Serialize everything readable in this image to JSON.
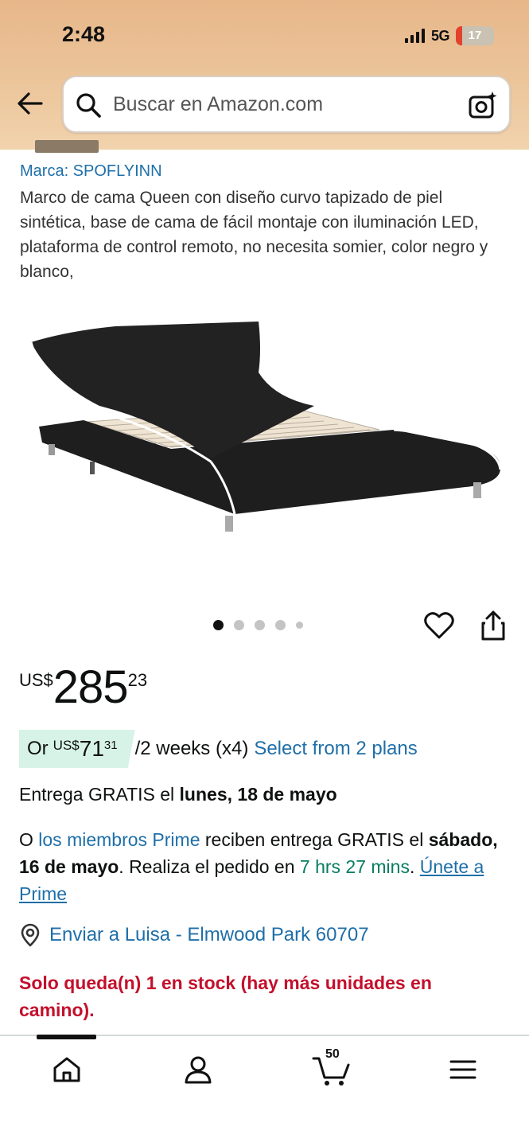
{
  "status_bar": {
    "time": "2:48",
    "network": "5G",
    "battery_level": "17",
    "battery_color": "#e2412d"
  },
  "search": {
    "placeholder": "Buscar en Amazon.com",
    "icons": [
      "back-arrow-icon",
      "search-icon",
      "camera-icon"
    ]
  },
  "product": {
    "brand": "Marca: SPOFLYINN",
    "title": "Marco de cama Queen con diseño curvo tapizado de piel sintética, base de cama de fácil montaje con iluminación LED, plataforma de control remoto, no necesita somier, color negro y blanco,",
    "carousel": {
      "total": 5,
      "active": 1
    },
    "price": {
      "symbol": "US$",
      "whole": "285",
      "fraction": "23"
    },
    "plan": {
      "prefix": "Or",
      "symbol": "US$",
      "amount": "71",
      "fraction": "31",
      "period": "/2 weeks (x4)",
      "link": "Select from 2 plans"
    },
    "delivery": {
      "prefix": "Entrega GRATIS el ",
      "date": "lunes, 18 de mayo"
    },
    "prime": {
      "p1": "O ",
      "link": "los miembros Prime",
      "p2": " reciben entrega GRATIS el ",
      "date": "sábado, 16 de mayo",
      "p3": ". Realiza el pedido en ",
      "countdown": "7 hrs 27 mins",
      "p4": ". ",
      "join": "Únete a Prime"
    },
    "location": "Enviar a Luisa - Elmwood Park 60707",
    "stock": "Solo queda(n) 1 en stock (hay más unidades en camino)."
  },
  "bottom_nav": {
    "items": [
      "home-icon",
      "account-icon",
      "cart-icon",
      "menu-icon"
    ],
    "cart_count": "50"
  },
  "colors": {
    "header": "#ecc59b",
    "link": "#1f6fa8",
    "stock": "#c40f2b",
    "countdown": "#067d62",
    "plan_badge": "#d7f3e7"
  }
}
